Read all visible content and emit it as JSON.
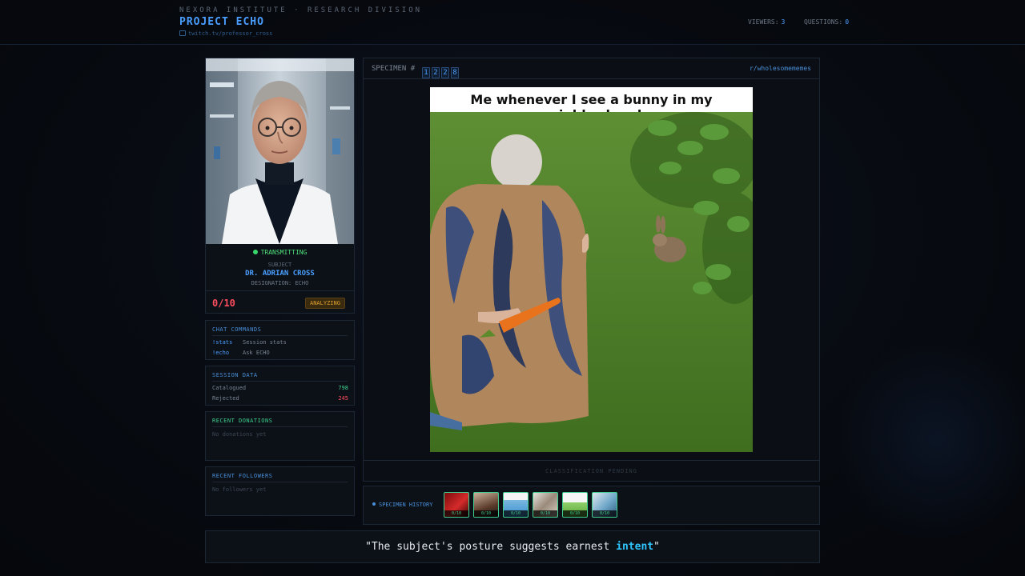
{
  "header": {
    "org": "NEXORA INSTITUTE · RESEARCH DIVISION",
    "title": "PROJECT ECHO",
    "link": "twitch.tv/professor_cross",
    "viewers_label": "VIEWERS:",
    "viewers_value": "3",
    "questions_label": "QUESTIONS:",
    "questions_value": "0"
  },
  "profile": {
    "status": "TRANSMITTING",
    "subject_label": "SUBJECT",
    "name": "DR. ADRIAN CROSS",
    "designation": "DESIGNATION: ECHO",
    "score": "0/10",
    "state": "ANALYZING"
  },
  "commands": {
    "title": "CHAT COMMANDS",
    "items": [
      {
        "cmd": "!stats",
        "desc": "Session stats"
      },
      {
        "cmd": "!echo",
        "desc": "Ask ECHO"
      }
    ]
  },
  "session": {
    "title": "SESSION DATA",
    "catalogued_label": "Catalogued",
    "catalogued_value": "798",
    "rejected_label": "Rejected",
    "rejected_value": "245",
    "catalogued_color": "#3ecf8e",
    "rejected_color": "#ff4d5e"
  },
  "donations": {
    "title": "RECENT DONATIONS",
    "empty": "No donations yet"
  },
  "followers": {
    "title": "RECENT FOLLOWERS",
    "empty": "No followers yet"
  },
  "specimen": {
    "label": "SPECIMEN #",
    "digits": [
      "1",
      "2",
      "2",
      "8"
    ],
    "source": "r/wholesomememes",
    "caption": "Me whenever I see a bunny in my neighborhood",
    "footer": "CLASSIFICATION PENDING"
  },
  "history": {
    "label": "SPECIMEN HISTORY",
    "items": [
      {
        "score": "0/10"
      },
      {
        "score": "0/10"
      },
      {
        "score": "0/10"
      },
      {
        "score": "0/10"
      },
      {
        "score": "0/10"
      },
      {
        "score": "0/10"
      }
    ]
  },
  "quote": {
    "open": "\"The subject's posture suggests earnest ",
    "highlight": "intent",
    "close": "\""
  },
  "colors": {
    "accent": "#4a9eff",
    "live": "#38d66b",
    "danger": "#ff4d5e",
    "warn": "#e0a030"
  }
}
